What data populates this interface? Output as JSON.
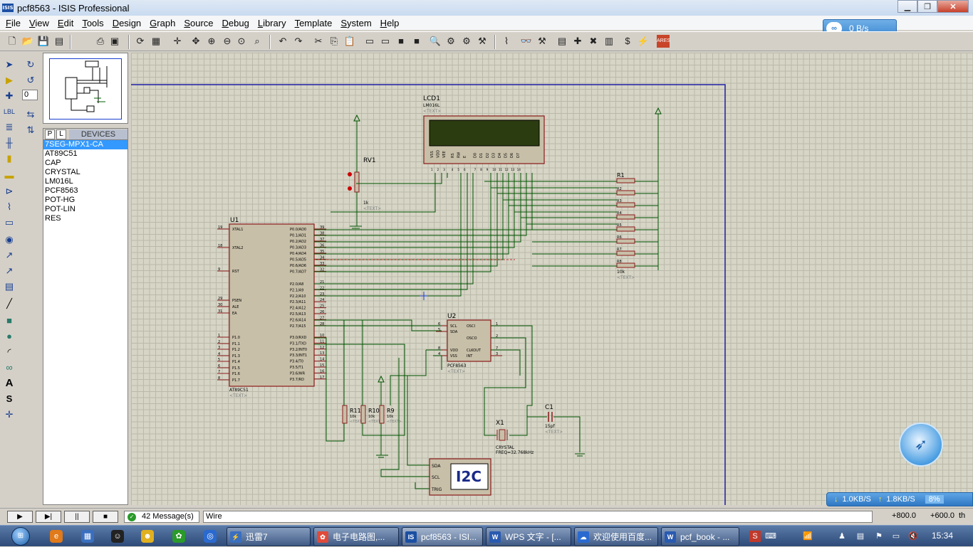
{
  "window": {
    "title": "pcf8563 - ISIS Professional",
    "app_icon": "ISIS"
  },
  "menu": [
    "File",
    "View",
    "Edit",
    "Tools",
    "Design",
    "Graph",
    "Source",
    "Debug",
    "Library",
    "Template",
    "System",
    "Help"
  ],
  "net_monitor": {
    "speed": "0 B/s"
  },
  "rotation_value": "0",
  "devices": {
    "tab_p": "P",
    "tab_l": "L",
    "title": "DEVICES",
    "items": [
      "7SEG-MPX1-CA",
      "AT89C51",
      "CAP",
      "CRYSTAL",
      "LM016L",
      "PCF8563",
      "POT-HG",
      "POT-LIN",
      "RES"
    ],
    "selected": "7SEG-MPX1-CA"
  },
  "schematic": {
    "lcd": {
      "ref": "LCD1",
      "part": "LM016L",
      "text": "<TEXT>",
      "pins": [
        "VSS",
        "VDD",
        "VEE",
        "RS",
        "RW",
        "E",
        "D0",
        "D1",
        "D2",
        "D3",
        "D4",
        "D5",
        "D6",
        "D7"
      ],
      "pin_nums": [
        "1",
        "2",
        "3",
        "4",
        "5",
        "6",
        "7",
        "8",
        "9",
        "10",
        "11",
        "12",
        "13",
        "14"
      ]
    },
    "rv1": {
      "ref": "RV1",
      "value": "1k",
      "text": "<TEXT>"
    },
    "r1": {
      "ref": "R1",
      "labels": [
        "R2",
        "R3",
        "R4",
        "R5",
        "R6",
        "R7",
        "R8"
      ],
      "value": "10k",
      "text": "<TEXT>"
    },
    "u1": {
      "ref": "U1",
      "part": "AT89C51",
      "text": "<TEXT>",
      "left_pins": [
        {
          "n": "19",
          "l": "XTAL1"
        },
        {
          "n": "18",
          "l": "XTAL2"
        },
        {
          "n": "9",
          "l": "RST"
        },
        {
          "n": "29",
          "l": "PSEN"
        },
        {
          "n": "30",
          "l": "ALE"
        },
        {
          "n": "31",
          "l": "EA"
        },
        {
          "n": "1",
          "l": "P1.0"
        },
        {
          "n": "2",
          "l": "P1.1"
        },
        {
          "n": "3",
          "l": "P1.2"
        },
        {
          "n": "4",
          "l": "P1.3"
        },
        {
          "n": "5",
          "l": "P1.4"
        },
        {
          "n": "6",
          "l": "P1.5"
        },
        {
          "n": "7",
          "l": "P1.6"
        },
        {
          "n": "8",
          "l": "P1.7"
        }
      ],
      "right_pins": [
        {
          "n": "39",
          "l": "P0.0/AD0"
        },
        {
          "n": "38",
          "l": "P0.1/AD1"
        },
        {
          "n": "37",
          "l": "P0.2/AD2"
        },
        {
          "n": "36",
          "l": "P0.3/AD3"
        },
        {
          "n": "35",
          "l": "P0.4/AD4"
        },
        {
          "n": "34",
          "l": "P0.5/AD5"
        },
        {
          "n": "33",
          "l": "P0.6/AD6"
        },
        {
          "n": "32",
          "l": "P0.7/AD7"
        },
        {
          "n": "21",
          "l": "P2.0/A8"
        },
        {
          "n": "22",
          "l": "P2.1/A9"
        },
        {
          "n": "23",
          "l": "P2.2/A10"
        },
        {
          "n": "24",
          "l": "P2.3/A11"
        },
        {
          "n": "25",
          "l": "P2.4/A12"
        },
        {
          "n": "26",
          "l": "P2.5/A13"
        },
        {
          "n": "27",
          "l": "P2.6/A14"
        },
        {
          "n": "28",
          "l": "P2.7/A15"
        },
        {
          "n": "10",
          "l": "P3.0/RXD"
        },
        {
          "n": "11",
          "l": "P3.1/TXD"
        },
        {
          "n": "12",
          "l": "P3.2/INT0"
        },
        {
          "n": "13",
          "l": "P3.3/INT1"
        },
        {
          "n": "14",
          "l": "P3.4/T0"
        },
        {
          "n": "15",
          "l": "P3.5/T1"
        },
        {
          "n": "16",
          "l": "P3.6/WR"
        },
        {
          "n": "17",
          "l": "P3.7/RD"
        }
      ]
    },
    "u2": {
      "ref": "U2",
      "part": "PCF8563",
      "text": "<TEXT>",
      "pins_left": [
        {
          "n": "6",
          "l": "SCL"
        },
        {
          "n": "5",
          "l": "SDA"
        },
        {
          "n": "8",
          "l": "VDD"
        },
        {
          "n": "4",
          "l": "VSS"
        }
      ],
      "pins_right": [
        {
          "n": "1",
          "l": "OSCI"
        },
        {
          "n": "2",
          "l": "OSCO"
        },
        {
          "n": "7",
          "l": "CLKOUT"
        },
        {
          "n": "3",
          "l": "INT"
        }
      ]
    },
    "pullups": [
      {
        "ref": "R11",
        "value": "10k"
      },
      {
        "ref": "R10",
        "value": "10k"
      },
      {
        "ref": "R9",
        "value": "10k"
      }
    ],
    "x1": {
      "ref": "X1",
      "part": "CRYSTAL",
      "freq": "FREQ=32.768kHz"
    },
    "c1": {
      "ref": "C1",
      "value": "15pf",
      "text": "<TEXT>"
    },
    "i2c": {
      "label": "I2C",
      "pins": [
        "SDA",
        "SCL",
        "TRIG"
      ]
    }
  },
  "speed_monitor": {
    "down": "1.0KB/S",
    "up": "1.8KB/S",
    "cpu": "8%"
  },
  "status": {
    "messages": "42 Message(s)",
    "wire": "Wire",
    "x": "+800.0",
    "y": "+600.0",
    "unit": "th"
  },
  "sim": {
    "play": "▶",
    "step": "▶|",
    "pause": "||",
    "stop": "■"
  },
  "taskbar": {
    "tasks": [
      "迅雷7",
      "电子电路图,...",
      "pcf8563 - ISI...",
      "WPS 文字 - [...",
      "欢迎使用百度...",
      "pcf_book - ..."
    ],
    "clock": "15:34"
  }
}
